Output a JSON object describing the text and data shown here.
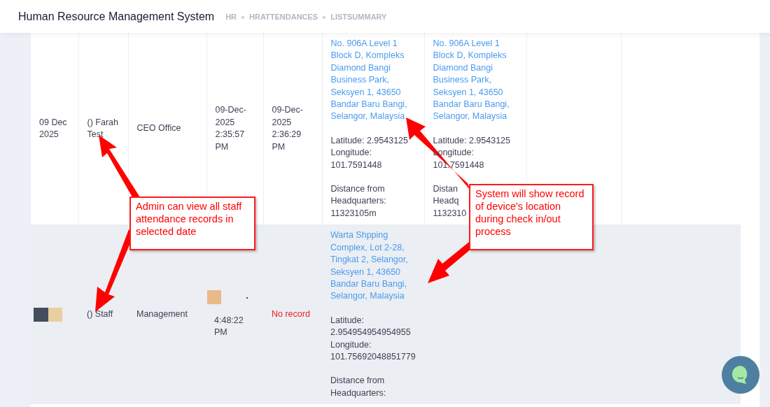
{
  "header": {
    "title": "Human Resource Management System",
    "breadcrumbs": [
      "HR",
      "HRATTENDANCES",
      "LISTSUMMARY"
    ]
  },
  "rows": [
    {
      "highlighted": false,
      "cells": [
        {
          "kind": "text",
          "text": "09 Dec 2025"
        },
        {
          "kind": "text",
          "text": "() Farah Test"
        },
        {
          "kind": "text",
          "text": "CEO Office"
        },
        {
          "kind": "text",
          "text": "09-Dec-2025 2:35:57 PM"
        },
        {
          "kind": "text",
          "text": "09-Dec-2025 2:36:29 PM"
        },
        {
          "kind": "location",
          "address": "No. 906A Level 1 Block D, Kompleks Diamond Bangi Business Park, Seksyen 1, 43650 Bandar Baru Bangi, Selangor, Malaysia",
          "latitude": "Latitude: 2.9543125",
          "longitude": "Longitude: 101.7591448",
          "distance": [
            "Distance from",
            "Headquarters:",
            "11323105m"
          ]
        },
        {
          "kind": "location",
          "address": "No. 906A Level 1 Block D, Kompleks Diamond Bangi Business Park, Seksyen 1, 43650 Bandar Baru Bangi, Selangor, Malaysia",
          "latitude": "Latitude: 2.9543125",
          "longitude": "Longitude: 101.7591448",
          "distance": [
            "Distan",
            "Headq",
            "1132310"
          ]
        },
        {
          "kind": "empty"
        },
        {
          "kind": "empty"
        }
      ]
    },
    {
      "highlighted": true,
      "cells": [
        {
          "kind": "images"
        },
        {
          "kind": "text",
          "text": "() Staff"
        },
        {
          "kind": "text",
          "text": "Management"
        },
        {
          "kind": "image_text",
          "text": "4:48:22 PM"
        },
        {
          "kind": "alert",
          "text": "No record"
        },
        {
          "kind": "location",
          "address": "Warta Shpping Complex, Lot 2-28, Tingkat 2, Selangor, Seksyen 1, 43650 Bandar Baru Bangi, Selangor, Malaysia",
          "latitude": "Latitude: 2.954954954954955",
          "longitude": "Longitude: 101.75692048851779",
          "distance": [
            "Distance from",
            "Headquarters:"
          ]
        },
        {
          "kind": "empty"
        },
        {
          "kind": "empty"
        },
        {
          "kind": "empty"
        }
      ]
    }
  ],
  "annotations": [
    {
      "text": "Admin can view all staff attendance records in selected date"
    },
    {
      "text": "System will show record of device's location during check in/out process"
    }
  ]
}
